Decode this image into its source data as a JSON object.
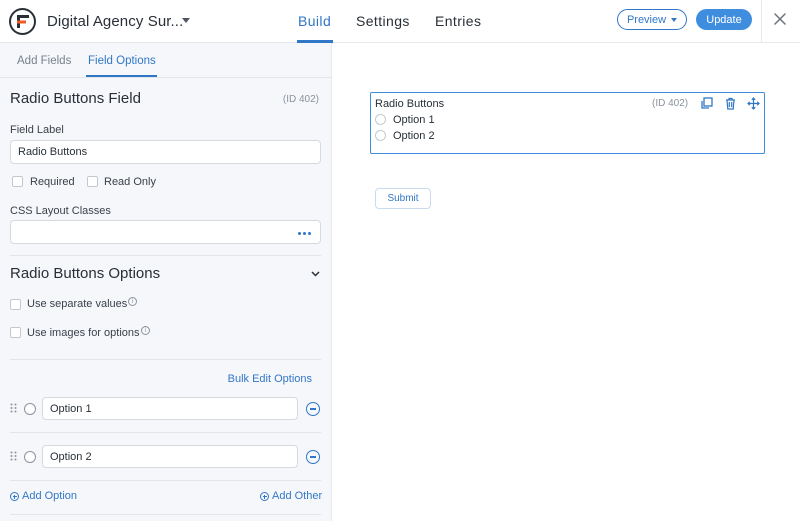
{
  "header": {
    "form_title": "Digital Agency Sur...",
    "tabs": [
      {
        "label": "Build",
        "active": true
      },
      {
        "label": "Settings",
        "active": false
      },
      {
        "label": "Entries",
        "active": false
      }
    ],
    "preview_label": "Preview",
    "update_label": "Update",
    "accent_color": "#3177c7"
  },
  "sidebar": {
    "tabs": [
      {
        "label": "Add Fields",
        "active": false
      },
      {
        "label": "Field Options",
        "active": true
      }
    ],
    "field_heading": "Radio Buttons Field",
    "field_id": "(ID 402)",
    "field_label_title": "Field Label",
    "field_label_value": "Radio Buttons",
    "required_label": "Required",
    "required_checked": false,
    "read_only_label": "Read Only",
    "read_only_checked": false,
    "css_classes_title": "CSS Layout Classes",
    "css_classes_value": "",
    "options_section_title": "Radio Buttons Options",
    "separate_values_label": "Use separate values",
    "separate_values_checked": false,
    "images_label": "Use images for options",
    "images_checked": false,
    "bulk_edit_label": "Bulk Edit Options",
    "options": [
      {
        "value": "Option 1"
      },
      {
        "value": "Option 2"
      }
    ],
    "add_option_label": "Add Option",
    "add_other_label": "Add Other"
  },
  "preview": {
    "field_label": "Radio Buttons",
    "field_id": "(ID 402)",
    "options": [
      "Option 1",
      "Option 2"
    ],
    "submit_label": "Submit"
  }
}
